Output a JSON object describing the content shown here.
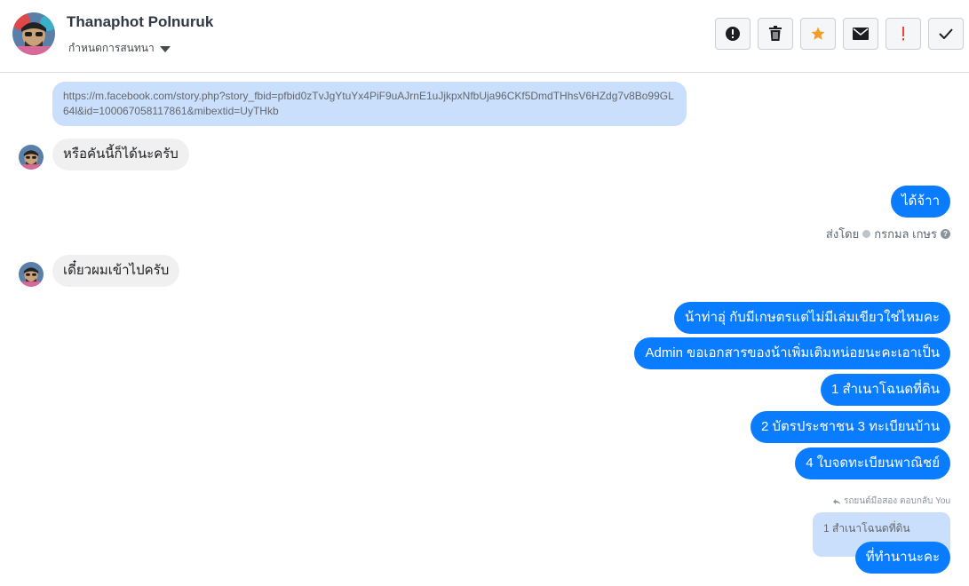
{
  "header": {
    "contact_name": "Thanaphot Polnuruk",
    "conversation_menu": "กำหนดการสนทนา"
  },
  "toolbar": {
    "buttons": [
      {
        "icon": "alert-circle-icon",
        "label": "spam"
      },
      {
        "icon": "trash-icon",
        "label": "delete"
      },
      {
        "icon": "star-icon",
        "label": "star"
      },
      {
        "icon": "envelope-icon",
        "label": "mark-unread"
      },
      {
        "icon": "exclamation-icon",
        "label": "flag"
      },
      {
        "icon": "check-icon",
        "label": "done"
      }
    ]
  },
  "messages": {
    "link_text": "https://m.facebook.com/story.php?story_fbid=pfbid0zTvJgYtuYx4PiF9uAJrnE1uJjkpxNfbUja96CKf5DmdTHhsV6HZdg7v8Bo99GL64l&id=100067058117861&mibextid=UyTHkb",
    "in_1": "หรือคันนี้ก็ได้นะครับ",
    "out_1": "ได้จ้าา",
    "sent_by_label": "ส่งโดย",
    "sent_by_name": "กรกมล เกษร",
    "in_2": "เดี๋ยวผมเข้าไปครับ",
    "out_2": "น้าท่าอุ่ กับมีเกษตรแต่ไม่มีเล่มเขียวใช่ไหมคะ",
    "out_3": "Admin ขอเอกสารของน้าเพิ่มเติมหน่อยนะคะเอาเป็น",
    "out_4": "1 สำเนาโฉนดที่ดิน",
    "out_5": "2 บัตรประชาชน 3 ทะเบียนบ้าน",
    "out_6": "4 ใบจดทะเบียนพาณิชย์",
    "reply_meta": "รถยนต์มือสอง ตอบกลับ You",
    "quoted_text": "1 สำเนาโฉนดที่ดิน",
    "out_7": "ที่ทำนานะคะ"
  },
  "colors": {
    "outgoing_bubble": "#0a7cff",
    "incoming_bubble": "#f0f0f0",
    "link_bubble": "#c9dffc",
    "star": "#f79b27",
    "flag": "#fa3e3e"
  }
}
